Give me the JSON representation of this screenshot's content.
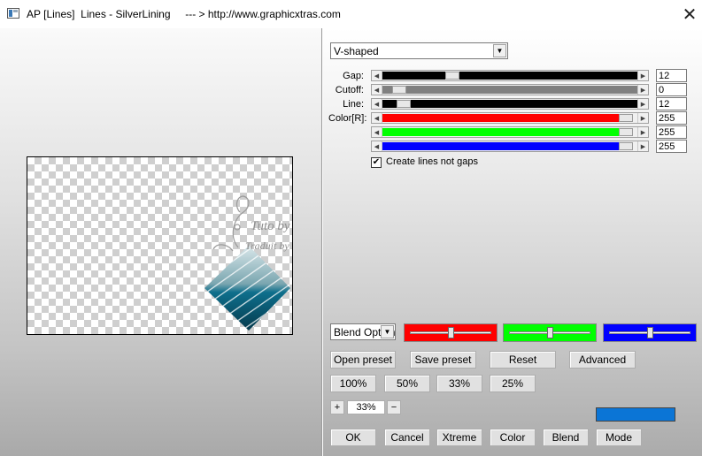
{
  "window": {
    "title": "AP [Lines]  Lines - SilverLining     --- > http://www.graphicxtras.com",
    "close_glyph": "✕"
  },
  "preview": {
    "watermark_line1": "Tuto by Le Monde de Bea",
    "watermark_line2": "Traduit by Neusa Novaes",
    "shape_color": "#1f7f9a"
  },
  "effect_select": {
    "value": "V-shaped"
  },
  "params": [
    {
      "label": "Gap:",
      "value": "12",
      "fill_color": "#000000",
      "fraction": 0.26
    },
    {
      "label": "Cutoff:",
      "value": "0",
      "fill_color": "#808080",
      "fraction": 0.04
    },
    {
      "label": "Line:",
      "value": "12",
      "fill_color": "#000000",
      "fraction": 0.06
    },
    {
      "label": "Color[R]:",
      "value": "255",
      "fill_color": "#ff0000",
      "fraction": 0.98
    },
    {
      "label": "",
      "value": "255",
      "fill_color": "#00ff00",
      "fraction": 0.98
    },
    {
      "label": "",
      "value": "255",
      "fill_color": "#0000ff",
      "fraction": 0.98
    }
  ],
  "checkbox": {
    "label": "Create lines not gaps",
    "checked": true,
    "mark": "✔"
  },
  "blend_select": {
    "value": "Blend Options"
  },
  "color_sliders": [
    {
      "name": "red",
      "color": "#ff0000",
      "fraction": 0.5
    },
    {
      "name": "green",
      "color": "#00ff00",
      "fraction": 0.5
    },
    {
      "name": "blue",
      "color": "#0000ff",
      "fraction": 0.5
    }
  ],
  "buttons": {
    "open_preset": "Open preset",
    "save_preset": "Save preset",
    "reset": "Reset",
    "advanced": "Advanced",
    "zoom_100": "100%",
    "zoom_50": "50%",
    "zoom_33": "33%",
    "zoom_25": "25%",
    "plus": "+",
    "minus": "−",
    "ok": "OK",
    "cancel": "Cancel",
    "xtreme": "Xtreme",
    "color": "Color",
    "blend": "Blend",
    "mode": "Mode"
  },
  "zoom_value": "33%",
  "swatch_color": "#0b75d6"
}
